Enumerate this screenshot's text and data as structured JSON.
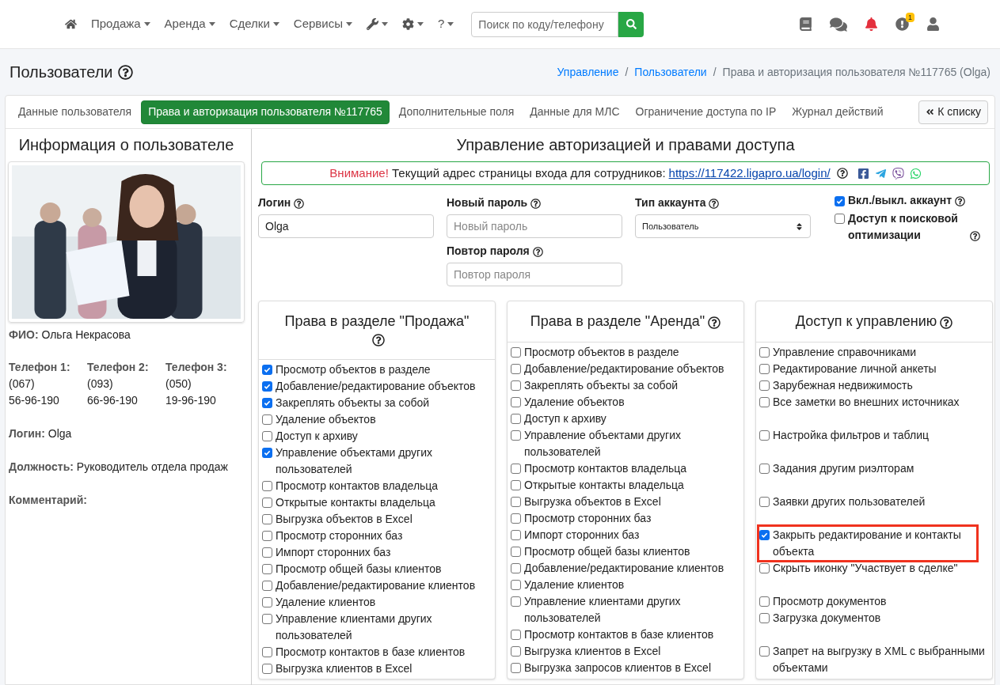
{
  "navbar": {
    "menu": [
      {
        "kind": "home"
      },
      {
        "kind": "text",
        "label": "Продажа"
      },
      {
        "kind": "text",
        "label": "Аренда"
      },
      {
        "kind": "text",
        "label": "Сделки"
      },
      {
        "kind": "text",
        "label": "Сервисы"
      },
      {
        "kind": "wrench"
      },
      {
        "kind": "gear"
      },
      {
        "kind": "text",
        "label": "?"
      }
    ],
    "search": {
      "placeholder": "Поиск по коду/телефону"
    },
    "icons": [
      {
        "kind": "book"
      },
      {
        "kind": "comments"
      },
      {
        "kind": "bell"
      },
      {
        "kind": "alert",
        "badge": "1"
      },
      {
        "kind": "user"
      }
    ]
  },
  "page": {
    "title": "Пользователи",
    "separator": "/",
    "breadcrumbs": [
      {
        "label": "Управление",
        "link": true
      },
      {
        "label": "Пользователи",
        "link": true
      },
      {
        "label": "Права и авторизация пользователя №117765 (Olga)",
        "link": false
      }
    ]
  },
  "tabs": [
    {
      "label": "Данные пользователя",
      "selected": false
    },
    {
      "label": "Права и авторизация пользователя №117765",
      "selected": true
    },
    {
      "label": "Дополнительные поля",
      "selected": false
    },
    {
      "label": "Данные для МЛС",
      "selected": false
    },
    {
      "label": "Ограничение доступа по IP",
      "selected": false
    },
    {
      "label": "Журнал действий",
      "selected": false
    }
  ],
  "back_button": "К списку",
  "user_info": {
    "title": "Информация о пользователе",
    "fio": {
      "label": "ФИО:",
      "value": "Ольга Некрасова"
    },
    "phones": [
      {
        "label": "Телефон 1:",
        "code": "(067)",
        "number": "56-96-190"
      },
      {
        "label": "Телефон 2:",
        "code": "(093)",
        "number": "66-96-190"
      },
      {
        "label": "Телефон 3:",
        "code": "(050)",
        "number": "19-96-190"
      }
    ],
    "fields": [
      {
        "label": "Логин:",
        "value": "Olga"
      },
      {
        "label": "Должность:",
        "value": "Руководитель отдела продаж"
      },
      {
        "label": "Комментарий:"
      }
    ]
  },
  "auth": {
    "title": "Управление авторизацией и правами доступа",
    "notice": {
      "warning": "Внимание!",
      "text": "Текущий адрес страницы входа для сотрудников:",
      "url": "https://117422.ligapro.ua/login/",
      "share": [
        {
          "kind": "facebook"
        },
        {
          "kind": "telegram"
        },
        {
          "kind": "viber"
        },
        {
          "kind": "whatsapp"
        }
      ]
    },
    "login": {
      "label": "Логин",
      "value": "Olga"
    },
    "new_password": {
      "label": "Новый пароль",
      "placeholder": "Новый пароль"
    },
    "repeat_password": {
      "label": "Повтор пароля",
      "placeholder": "Повтор пароля"
    },
    "account_type": {
      "label": "Тип аккаунта",
      "value": "Пользователь"
    },
    "account_enabled": {
      "label": "Вкл./выкл. аккаунт",
      "checked": true
    },
    "seo_access": {
      "label": "Доступ к поисковой оптимизации",
      "checked": false
    }
  },
  "panels": [
    {
      "title": "Права в разделе \"Продажа\"",
      "items": [
        {
          "label": "Просмотр объектов в разделе",
          "checked": true
        },
        {
          "label": "Добавление/редактирование объектов",
          "checked": true
        },
        {
          "label": "Закреплять объекты за собой",
          "checked": true
        },
        {
          "label": "Удаление объектов",
          "checked": false
        },
        {
          "label": "Доступ к архиву",
          "checked": false
        },
        {
          "label": "Управление объектами других пользователей",
          "checked": true
        },
        {
          "label": "Просмотр контактов владельца",
          "checked": false
        },
        {
          "label": "Открытые контакты владельца",
          "checked": false
        },
        {
          "label": "Выгрузка объектов в Excel",
          "checked": false
        },
        {
          "label": "Просмотр сторонних баз",
          "checked": false
        },
        {
          "label": "Импорт сторонних баз",
          "checked": false
        },
        {
          "label": "Просмотр общей базы клиентов",
          "checked": false
        },
        {
          "label": "Добавление/редактирование клиентов",
          "checked": false
        },
        {
          "label": "Удаление клиентов",
          "checked": false
        },
        {
          "label": "Управление клиентами других пользователей",
          "checked": false
        },
        {
          "label": "Просмотр контактов в базе клиентов",
          "checked": false
        },
        {
          "label": "Выгрузка клиентов в Excel",
          "checked": false
        }
      ]
    },
    {
      "title": "Права в разделе \"Аренда\"",
      "items": [
        {
          "label": "Просмотр объектов в разделе",
          "checked": false
        },
        {
          "label": "Добавление/редактирование объектов",
          "checked": false
        },
        {
          "label": "Закреплять объекты за собой",
          "checked": false
        },
        {
          "label": "Удаление объектов",
          "checked": false
        },
        {
          "label": "Доступ к архиву",
          "checked": false
        },
        {
          "label": "Управление объектами других пользователей",
          "checked": false
        },
        {
          "label": "Просмотр контактов владельца",
          "checked": false
        },
        {
          "label": "Открытые контакты владельца",
          "checked": false
        },
        {
          "label": "Выгрузка объектов в Excel",
          "checked": false
        },
        {
          "label": "Просмотр сторонних баз",
          "checked": false
        },
        {
          "label": "Импорт сторонних баз",
          "checked": false
        },
        {
          "label": "Просмотр общей базы клиентов",
          "checked": false
        },
        {
          "label": "Добавление/редактирование клиентов",
          "checked": false
        },
        {
          "label": "Удаление клиентов",
          "checked": false
        },
        {
          "label": "Управление клиентами других пользователей",
          "checked": false
        },
        {
          "label": "Просмотр контактов в базе клиентов",
          "checked": false
        },
        {
          "label": "Выгрузка клиентов в Excel",
          "checked": false
        },
        {
          "label": "Выгрузка запросов клиентов в Excel",
          "checked": false
        }
      ]
    },
    {
      "title": "Доступ к управлению",
      "groups": [
        {
          "items": [
            {
              "label": "Управление справочниками",
              "checked": false,
              "highlighted": false
            },
            {
              "label": "Редактирование личной анкеты",
              "checked": false,
              "highlighted": false
            },
            {
              "label": "Зарубежная недвижимость",
              "checked": false,
              "highlighted": false
            },
            {
              "label": "Все заметки во внешних источниках",
              "checked": false,
              "highlighted": false
            }
          ]
        },
        {
          "items": [
            {
              "label": "Настройка фильтров и таблиц",
              "checked": false,
              "highlighted": false
            }
          ]
        },
        {
          "items": [
            {
              "label": "Задания другим риэлторам",
              "checked": false,
              "highlighted": false
            }
          ]
        },
        {
          "items": [
            {
              "label": "Заявки других пользователей",
              "checked": false,
              "highlighted": false
            }
          ]
        },
        {
          "items": [
            {
              "label": "Закрыть редактирование и контакты объекта",
              "checked": true,
              "highlighted": true
            },
            {
              "label": "Скрыть иконку \"Участвует в сделке\"",
              "checked": false,
              "highlighted": false
            }
          ]
        },
        {
          "items": [
            {
              "label": "Просмотр документов",
              "checked": false,
              "highlighted": false
            },
            {
              "label": "Загрузка документов",
              "checked": false,
              "highlighted": false
            }
          ]
        },
        {
          "items": [
            {
              "label": "Запрет на выгрузку в XML с выбранными объектами",
              "checked": false,
              "highlighted": false
            }
          ]
        }
      ]
    }
  ]
}
